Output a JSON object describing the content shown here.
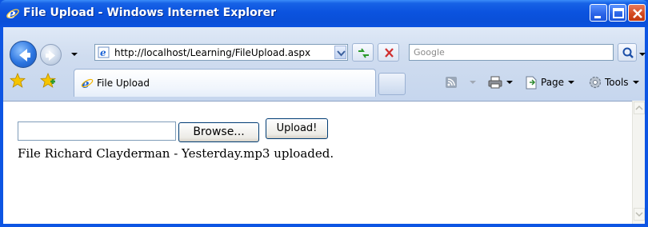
{
  "window": {
    "title": "File Upload - Windows Internet Explorer",
    "icon": "ie-icon",
    "controls": [
      "minimize-icon",
      "maximize-icon",
      "close-icon"
    ]
  },
  "navigation": {
    "back_icon": "back-arrow-icon",
    "forward_icon": "forward-arrow-icon",
    "address": {
      "url": "http://localhost/Learning/FileUpload.aspx",
      "icon": "ie-page-icon"
    },
    "refresh_icon": "refresh-icon",
    "stop_icon": "stop-icon",
    "search": {
      "placeholder": "Google",
      "icon": "search-icon"
    }
  },
  "toolbar": {
    "tab_label": "File Upload",
    "commands": {
      "page_label": "Page",
      "tools_label": "Tools"
    }
  },
  "page": {
    "browse_label": "Browse...",
    "upload_label": "Upload!",
    "file_input_value": "",
    "status_message": "File Richard Clayderman - Yesterday.mp3 uploaded."
  },
  "colors": {
    "titlebar": "#0b53df",
    "chrome": "#cfdcef",
    "content_bg": "#ffffff"
  }
}
